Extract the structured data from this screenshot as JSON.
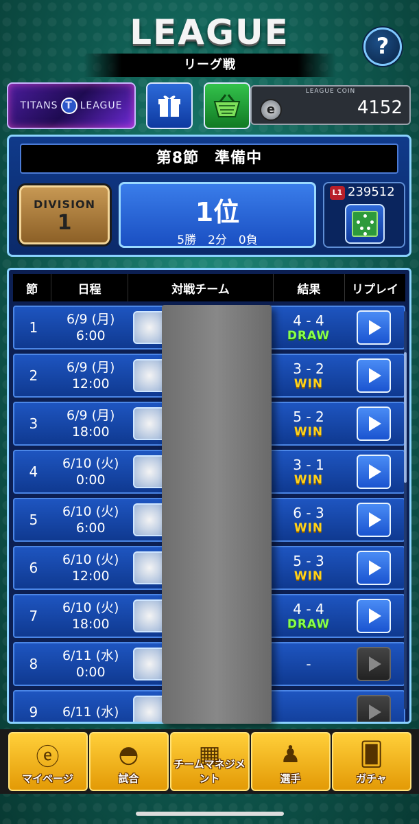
{
  "header": {
    "title": "LEAGUE",
    "subtitle": "リーグ戦",
    "help_label": "?"
  },
  "top_row": {
    "banner_text_left": "TITANS",
    "banner_logo": "T",
    "banner_text_right": "LEAGUE",
    "coin_label": "LEAGUE COIN",
    "coin_value": "4152"
  },
  "status": {
    "round_text": "第8節　準備中",
    "division_label": "DIVISION",
    "division_value": "1",
    "rank": "1位",
    "record": "5勝　2分　0負",
    "l1_badge": "L1",
    "l1_value": "239512"
  },
  "table": {
    "headers": [
      "節",
      "日程",
      "対戦チーム",
      "結果",
      "リプレイ"
    ],
    "rows": [
      {
        "no": "1",
        "date": "6/9 (月)",
        "time": "6:00",
        "score": "4 - 4",
        "outcome": "DRAW"
      },
      {
        "no": "2",
        "date": "6/9 (月)",
        "time": "12:00",
        "score": "3 - 2",
        "outcome": "WIN"
      },
      {
        "no": "3",
        "date": "6/9 (月)",
        "time": "18:00",
        "score": "5 - 2",
        "outcome": "WIN"
      },
      {
        "no": "4",
        "date": "6/10 (火)",
        "time": "0:00",
        "score": "3 - 1",
        "outcome": "WIN"
      },
      {
        "no": "5",
        "date": "6/10 (火)",
        "time": "6:00",
        "score": "6 - 3",
        "outcome": "WIN"
      },
      {
        "no": "6",
        "date": "6/10 (火)",
        "time": "12:00",
        "score": "5 - 3",
        "outcome": "WIN"
      },
      {
        "no": "7",
        "date": "6/10 (火)",
        "time": "18:00",
        "score": "4 - 4",
        "outcome": "DRAW"
      },
      {
        "no": "8",
        "date": "6/11 (水)",
        "time": "0:00",
        "score": "-",
        "outcome": ""
      },
      {
        "no": "9",
        "date": "6/11 (水)",
        "time": "",
        "score": "",
        "outcome": ""
      }
    ]
  },
  "bottom_nav": [
    {
      "label": "マイページ",
      "icon": "e-logo-icon"
    },
    {
      "label": "試合",
      "icon": "stadium-icon"
    },
    {
      "label": "チームマネジメント",
      "icon": "formation-icon"
    },
    {
      "label": "選手",
      "icon": "players-icon"
    },
    {
      "label": "ガチャ",
      "icon": "cards-icon"
    }
  ],
  "colors": {
    "win": "#ffd21a",
    "draw": "#8aff4a",
    "accent_blue": "#1e55c0",
    "nav_gold": "#ffcf3a"
  }
}
